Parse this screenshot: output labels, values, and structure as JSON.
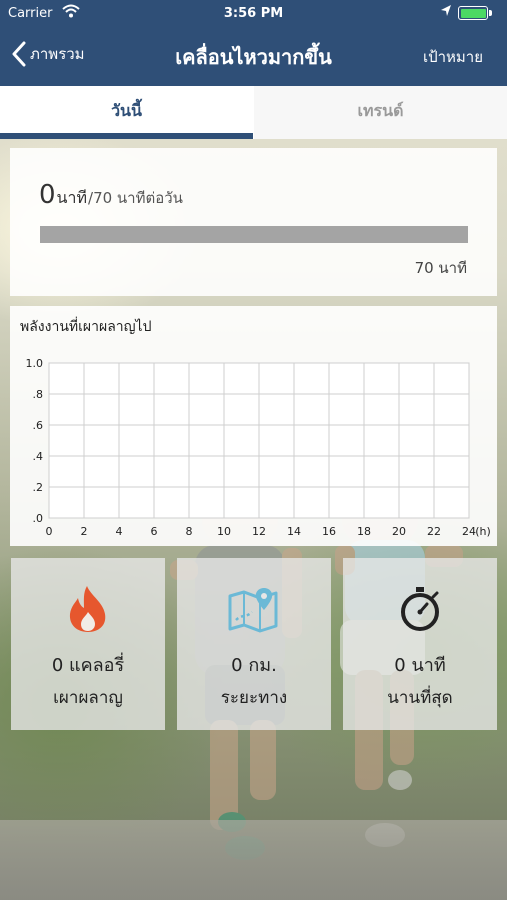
{
  "status_bar": {
    "carrier": "Carrier",
    "time": "3:56 PM"
  },
  "nav": {
    "back_label": "ภาพรวม",
    "title": "เคลื่อนไหวมากขึ้น",
    "right_label": "เป้าหมาย"
  },
  "tabs": [
    {
      "label": "วันนี้",
      "selected": true
    },
    {
      "label": "เทรนด์",
      "selected": false
    }
  ],
  "progress": {
    "value": "0",
    "unit": "นาที",
    "goal_text": "/70 นาทีต่อวัน",
    "max_label": "70 นาที",
    "fraction": 0
  },
  "chart_data": {
    "type": "line",
    "title": "พลังงานที่เผาผลาญไป",
    "x_ticks": [
      "0",
      "2",
      "4",
      "6",
      "8",
      "10",
      "12",
      "14",
      "16",
      "18",
      "20",
      "22",
      "24"
    ],
    "x_unit": "(h)",
    "y_ticks": [
      ".0",
      ".2",
      ".4",
      ".6",
      ".8",
      "1.0"
    ],
    "xlim": [
      0,
      24
    ],
    "ylim": [
      0,
      1.0
    ],
    "grid": true,
    "series": []
  },
  "stats": [
    {
      "icon": "flame-icon",
      "value": "0 แคลอรี่",
      "label": "เผาผลาญ"
    },
    {
      "icon": "map-pin-icon",
      "value": "0 กม.",
      "label": "ระยะทาง"
    },
    {
      "icon": "stopwatch-icon",
      "value": "0 นาที",
      "label": "นานที่สุด"
    }
  ],
  "colors": {
    "primary": "#2f4f77",
    "flame": "#e6572e",
    "map": "#6bb9d6",
    "stopwatch": "#222222"
  }
}
